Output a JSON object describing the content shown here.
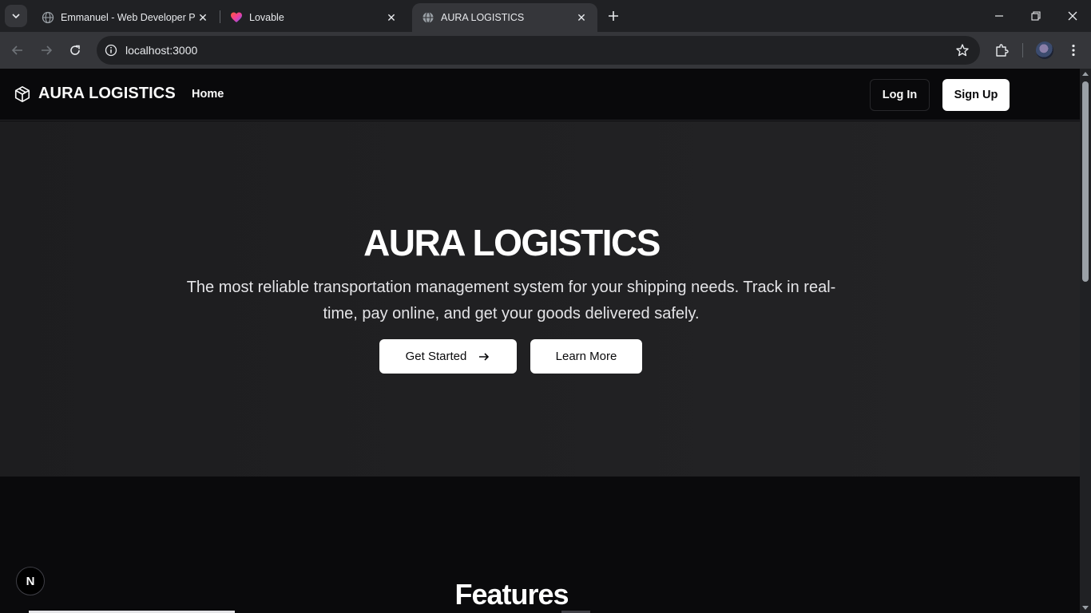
{
  "browser": {
    "tabs": [
      {
        "title": "Emmanuel - Web Developer Po",
        "favicon": "globe-icon",
        "active": false
      },
      {
        "title": "Lovable",
        "favicon": "lovable-heart-icon",
        "active": false
      },
      {
        "title": "AURA LOGISTICS",
        "favicon": "globe-icon",
        "active": true
      }
    ],
    "url": "localhost:3000"
  },
  "site": {
    "brand": "AURA LOGISTICS",
    "nav": {
      "home": "Home"
    },
    "auth": {
      "login": "Log In",
      "signup": "Sign Up"
    }
  },
  "hero": {
    "title": "AURA LOGISTICS",
    "subtitle": "The most reliable transportation management system for your shipping needs. Track in real-time, pay online, and get your goods delivered safely.",
    "cta_primary": "Get Started",
    "cta_secondary": "Learn More"
  },
  "features": {
    "title": "Features"
  },
  "devtools": {
    "badge": "N"
  }
}
